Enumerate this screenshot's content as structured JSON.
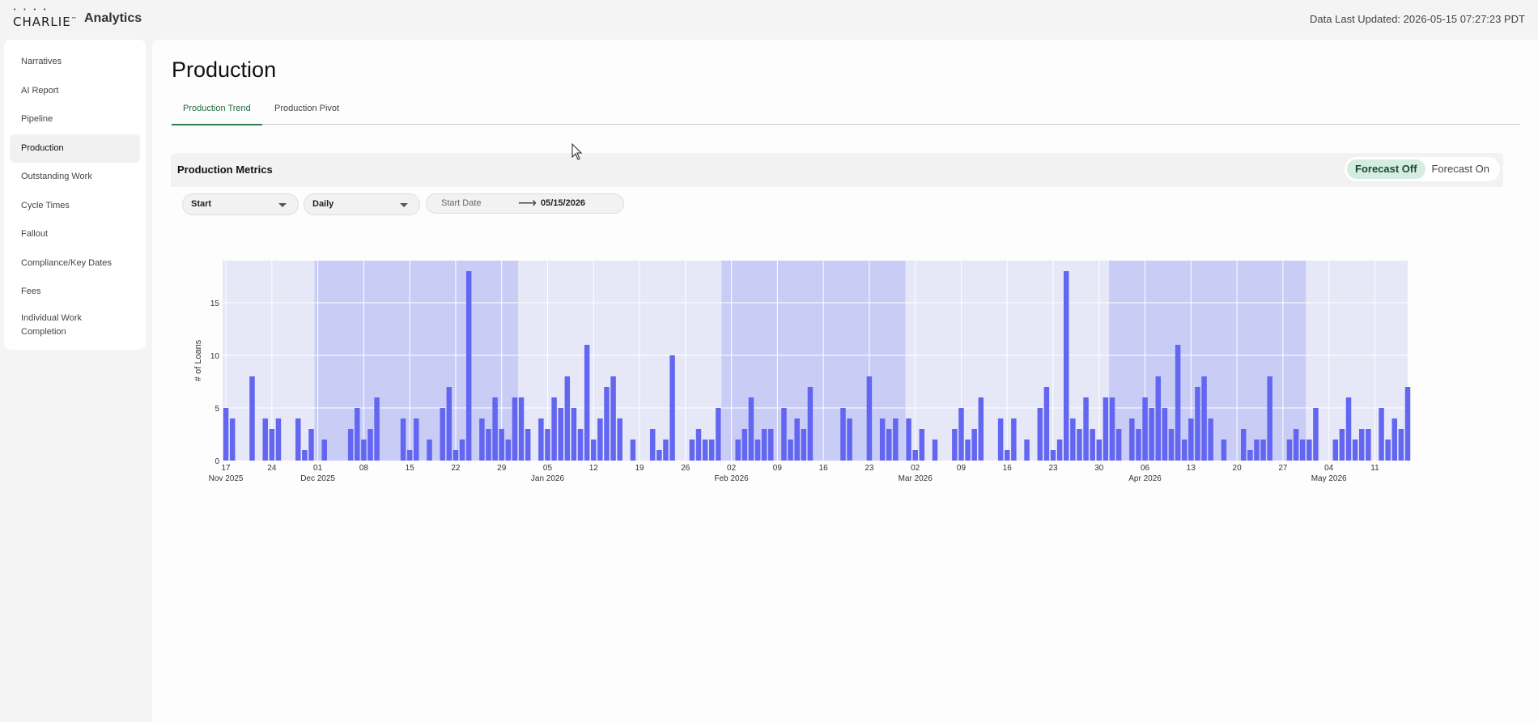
{
  "header": {
    "logo_text": "CHARLIE",
    "logo_tm": "™",
    "app_name": "Analytics",
    "last_updated": "Data Last Updated: 2026-05-15 07:27:23 PDT"
  },
  "sidebar": {
    "items": [
      {
        "label": "Narratives",
        "active": false
      },
      {
        "label": "AI Report",
        "active": false
      },
      {
        "label": "Pipeline",
        "active": false
      },
      {
        "label": "Production",
        "active": true
      },
      {
        "label": "Outstanding Work",
        "active": false
      },
      {
        "label": "Cycle Times",
        "active": false
      },
      {
        "label": "Fallout",
        "active": false
      },
      {
        "label": "Compliance/Key Dates",
        "active": false
      },
      {
        "label": "Fees",
        "active": false
      },
      {
        "label": "Individual Work Completion",
        "active": false
      }
    ]
  },
  "main": {
    "title": "Production",
    "tabs": [
      {
        "label": "Production Trend",
        "active": true
      },
      {
        "label": "Production Pivot",
        "active": false
      }
    ],
    "metrics": {
      "title": "Production Metrics",
      "forecast_off": "Forecast Off",
      "forecast_on": "Forecast On",
      "forecast_selected": "Forecast Off"
    },
    "filters": {
      "milestone": "Start",
      "interval": "Daily",
      "start_placeholder": "Start Date",
      "end_date": "05/15/2026"
    }
  },
  "colors": {
    "bar": "#6366f1",
    "month_band_dark": "#c9cdf6",
    "month_band_light": "#e6e8f8",
    "accent_green": "#2e7d55"
  },
  "chart_data": {
    "type": "bar",
    "ylabel": "# of Loans",
    "ylim": [
      0,
      19
    ],
    "y_ticks": [
      0,
      5,
      10,
      15
    ],
    "x_start": "2025-11-17",
    "x_end": "2026-05-15",
    "x_ticks": [
      {
        "date": "2025-11-17",
        "label": "17",
        "sublabel": "Nov 2025"
      },
      {
        "date": "2025-11-24",
        "label": "24",
        "sublabel": ""
      },
      {
        "date": "2025-12-01",
        "label": "01",
        "sublabel": "Dec 2025"
      },
      {
        "date": "2025-12-08",
        "label": "08",
        "sublabel": ""
      },
      {
        "date": "2025-12-15",
        "label": "15",
        "sublabel": ""
      },
      {
        "date": "2025-12-22",
        "label": "22",
        "sublabel": ""
      },
      {
        "date": "2025-12-29",
        "label": "29",
        "sublabel": ""
      },
      {
        "date": "2026-01-05",
        "label": "05",
        "sublabel": "Jan 2026"
      },
      {
        "date": "2026-01-12",
        "label": "12",
        "sublabel": ""
      },
      {
        "date": "2026-01-19",
        "label": "19",
        "sublabel": ""
      },
      {
        "date": "2026-01-26",
        "label": "26",
        "sublabel": ""
      },
      {
        "date": "2026-02-02",
        "label": "02",
        "sublabel": "Feb 2026"
      },
      {
        "date": "2026-02-09",
        "label": "09",
        "sublabel": ""
      },
      {
        "date": "2026-02-16",
        "label": "16",
        "sublabel": ""
      },
      {
        "date": "2026-02-23",
        "label": "23",
        "sublabel": ""
      },
      {
        "date": "2026-03-02",
        "label": "02",
        "sublabel": "Mar 2026"
      },
      {
        "date": "2026-03-09",
        "label": "09",
        "sublabel": ""
      },
      {
        "date": "2026-03-16",
        "label": "16",
        "sublabel": ""
      },
      {
        "date": "2026-03-23",
        "label": "23",
        "sublabel": ""
      },
      {
        "date": "2026-03-30",
        "label": "30",
        "sublabel": ""
      },
      {
        "date": "2026-04-06",
        "label": "06",
        "sublabel": "Apr 2026"
      },
      {
        "date": "2026-04-13",
        "label": "13",
        "sublabel": ""
      },
      {
        "date": "2026-04-20",
        "label": "20",
        "sublabel": ""
      },
      {
        "date": "2026-04-27",
        "label": "27",
        "sublabel": ""
      },
      {
        "date": "2026-05-04",
        "label": "04",
        "sublabel": "May 2026"
      },
      {
        "date": "2026-05-11",
        "label": "11",
        "sublabel": ""
      }
    ],
    "shaded_periods": [
      {
        "start": "2025-12-01",
        "end": "2026-01-01"
      },
      {
        "start": "2026-02-01",
        "end": "2026-03-01"
      },
      {
        "start": "2026-04-01",
        "end": "2026-05-01"
      }
    ],
    "bars": [
      [
        "2025-11-17",
        5
      ],
      [
        "2025-11-18",
        4
      ],
      [
        "2025-11-21",
        8
      ],
      [
        "2025-11-23",
        4
      ],
      [
        "2025-11-24",
        3
      ],
      [
        "2025-11-25",
        4
      ],
      [
        "2025-11-28",
        4
      ],
      [
        "2025-11-29",
        1
      ],
      [
        "2025-11-30",
        3
      ],
      [
        "2025-12-02",
        2
      ],
      [
        "2025-12-06",
        3
      ],
      [
        "2025-12-07",
        5
      ],
      [
        "2025-12-08",
        2
      ],
      [
        "2025-12-09",
        3
      ],
      [
        "2025-12-10",
        6
      ],
      [
        "2025-12-14",
        4
      ],
      [
        "2025-12-15",
        1
      ],
      [
        "2025-12-16",
        4
      ],
      [
        "2025-12-18",
        2
      ],
      [
        "2025-12-20",
        5
      ],
      [
        "2025-12-21",
        7
      ],
      [
        "2025-12-22",
        1
      ],
      [
        "2025-12-23",
        2
      ],
      [
        "2025-12-24",
        18
      ],
      [
        "2025-12-26",
        4
      ],
      [
        "2025-12-27",
        3
      ],
      [
        "2025-12-28",
        6
      ],
      [
        "2025-12-29",
        3
      ],
      [
        "2025-12-30",
        2
      ],
      [
        "2025-12-31",
        6
      ],
      [
        "2026-01-01",
        6
      ],
      [
        "2026-01-02",
        3
      ],
      [
        "2026-01-04",
        4
      ],
      [
        "2026-01-05",
        3
      ],
      [
        "2026-01-06",
        6
      ],
      [
        "2026-01-07",
        5
      ],
      [
        "2026-01-08",
        8
      ],
      [
        "2026-01-09",
        5
      ],
      [
        "2026-01-10",
        3
      ],
      [
        "2026-01-11",
        11
      ],
      [
        "2026-01-12",
        2
      ],
      [
        "2026-01-13",
        4
      ],
      [
        "2026-01-14",
        7
      ],
      [
        "2026-01-15",
        8
      ],
      [
        "2026-01-16",
        4
      ],
      [
        "2026-01-18",
        2
      ],
      [
        "2026-01-21",
        3
      ],
      [
        "2026-01-22",
        1
      ],
      [
        "2026-01-23",
        2
      ],
      [
        "2026-01-24",
        10
      ],
      [
        "2026-01-27",
        2
      ],
      [
        "2026-01-28",
        3
      ],
      [
        "2026-01-29",
        2
      ],
      [
        "2026-01-30",
        2
      ],
      [
        "2026-01-31",
        5
      ],
      [
        "2026-02-03",
        2
      ],
      [
        "2026-02-04",
        3
      ],
      [
        "2026-02-05",
        6
      ],
      [
        "2026-02-06",
        2
      ],
      [
        "2026-02-07",
        3
      ],
      [
        "2026-02-08",
        3
      ],
      [
        "2026-02-10",
        5
      ],
      [
        "2026-02-11",
        2
      ],
      [
        "2026-02-12",
        4
      ],
      [
        "2026-02-13",
        3
      ],
      [
        "2026-02-14",
        7
      ],
      [
        "2026-02-19",
        5
      ],
      [
        "2026-02-20",
        4
      ],
      [
        "2026-02-23",
        8
      ],
      [
        "2026-02-25",
        4
      ],
      [
        "2026-02-26",
        3
      ],
      [
        "2026-02-27",
        4
      ],
      [
        "2026-03-01",
        4
      ],
      [
        "2026-03-02",
        1
      ],
      [
        "2026-03-03",
        3
      ],
      [
        "2026-03-05",
        2
      ],
      [
        "2026-03-08",
        3
      ],
      [
        "2026-03-09",
        5
      ],
      [
        "2026-03-10",
        2
      ],
      [
        "2026-03-11",
        3
      ],
      [
        "2026-03-12",
        6
      ],
      [
        "2026-03-15",
        4
      ],
      [
        "2026-03-16",
        1
      ],
      [
        "2026-03-17",
        4
      ],
      [
        "2026-03-19",
        2
      ],
      [
        "2026-03-21",
        5
      ],
      [
        "2026-03-22",
        7
      ],
      [
        "2026-03-23",
        1
      ],
      [
        "2026-03-24",
        2
      ],
      [
        "2026-03-25",
        18
      ],
      [
        "2026-03-26",
        4
      ],
      [
        "2026-03-27",
        3
      ],
      [
        "2026-03-28",
        6
      ],
      [
        "2026-03-29",
        3
      ],
      [
        "2026-03-30",
        2
      ],
      [
        "2026-03-31",
        6
      ],
      [
        "2026-04-01",
        6
      ],
      [
        "2026-04-02",
        3
      ],
      [
        "2026-04-04",
        4
      ],
      [
        "2026-04-05",
        3
      ],
      [
        "2026-04-06",
        6
      ],
      [
        "2026-04-07",
        5
      ],
      [
        "2026-04-08",
        8
      ],
      [
        "2026-04-09",
        5
      ],
      [
        "2026-04-10",
        3
      ],
      [
        "2026-04-11",
        11
      ],
      [
        "2026-04-12",
        2
      ],
      [
        "2026-04-13",
        4
      ],
      [
        "2026-04-14",
        7
      ],
      [
        "2026-04-15",
        8
      ],
      [
        "2026-04-16",
        4
      ],
      [
        "2026-04-18",
        2
      ],
      [
        "2026-04-21",
        3
      ],
      [
        "2026-04-22",
        1
      ],
      [
        "2026-04-23",
        2
      ],
      [
        "2026-04-24",
        2
      ],
      [
        "2026-04-25",
        8
      ],
      [
        "2026-04-28",
        2
      ],
      [
        "2026-04-29",
        3
      ],
      [
        "2026-04-30",
        2
      ],
      [
        "2026-05-01",
        2
      ],
      [
        "2026-05-02",
        5
      ],
      [
        "2026-05-05",
        2
      ],
      [
        "2026-05-06",
        3
      ],
      [
        "2026-05-07",
        6
      ],
      [
        "2026-05-08",
        2
      ],
      [
        "2026-05-09",
        3
      ],
      [
        "2026-05-10",
        3
      ],
      [
        "2026-05-12",
        5
      ],
      [
        "2026-05-13",
        2
      ],
      [
        "2026-05-14",
        4
      ],
      [
        "2026-05-15",
        3
      ],
      [
        "2026-05-16",
        7
      ]
    ]
  }
}
